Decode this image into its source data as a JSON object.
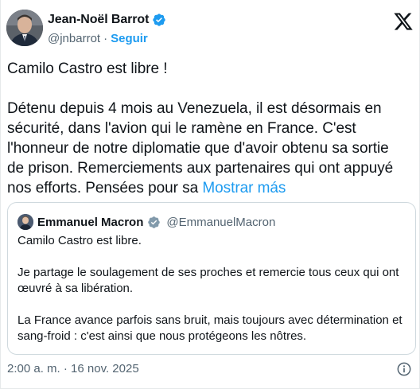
{
  "author": {
    "name": "Jean-Noël Barrot",
    "handle": "@jnbarrot",
    "separator": "·",
    "follow_label": "Seguir"
  },
  "tweet": {
    "line1": "Camilo Castro est libre !",
    "line2": "Détenu depuis 4 mois au Venezuela, il est désormais en sécurité, dans l'avion qui le ramène en France. C'est l'honneur de notre diplomatie que d'avoir obtenu sa sortie de prison. Remerciements aux partenaires qui ont appuyé nos efforts. Pensées pour sa ",
    "show_more": "Mostrar más"
  },
  "quote": {
    "name": "Emmanuel Macron",
    "handle": "@EmmanuelMacron",
    "p1": "Camilo Castro est libre.",
    "p2": "Je partage le soulagement de ses proches et remercie tous ceux qui ont œuvré à sa libération.",
    "p3": "La France avance parfois sans bruit, mais toujours avec détermination et sang-froid : c'est ainsi que nous protégeons les nôtres."
  },
  "meta": {
    "timestamp": "2:00 a. m. · 16 nov. 2025"
  },
  "colors": {
    "accent": "#1d9bf0",
    "verified": "#1d9bf0",
    "secondary_text": "#536471",
    "border": "#cfd9de"
  },
  "icons": {
    "verified": "verified-badge-icon",
    "brand": "x-logo-icon",
    "info": "info-icon"
  }
}
